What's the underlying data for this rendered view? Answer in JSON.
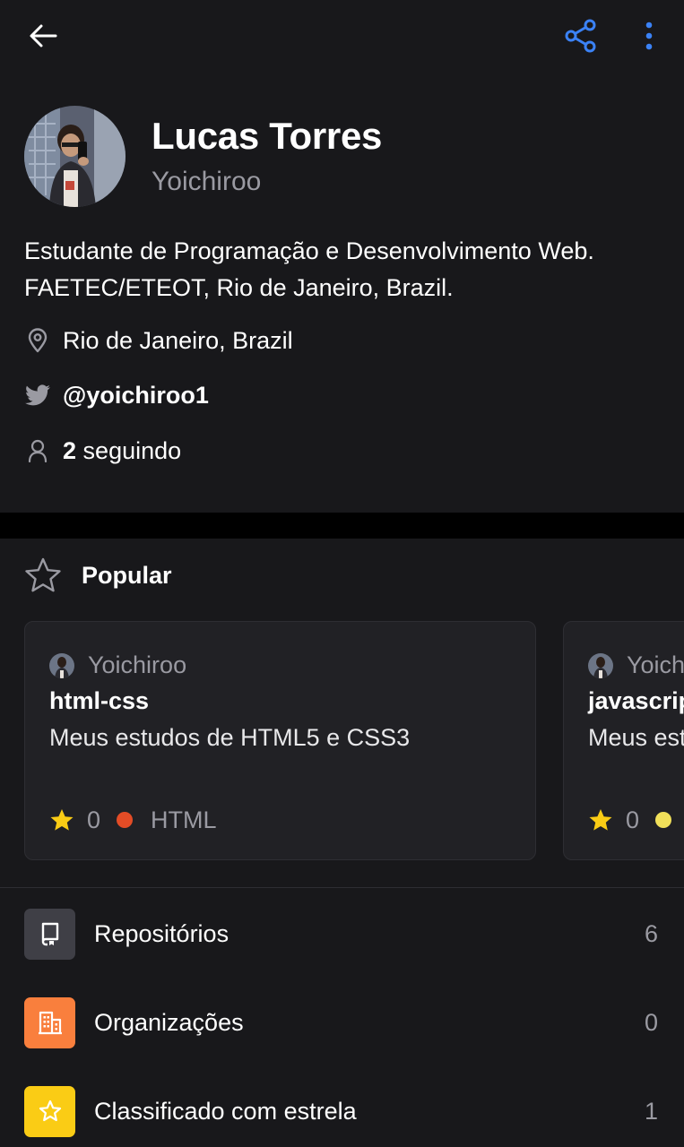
{
  "header": {
    "back_icon": "arrow-left-icon",
    "share_icon": "share-icon",
    "more_icon": "kebab-menu-icon",
    "accent": "#3b82f6"
  },
  "profile": {
    "name": "Lucas Torres",
    "login": "Yoichiroo",
    "bio_line1": "Estudante de Programação e Desenvolvimento Web.",
    "bio_line2": "FAETEC/ETEOT, Rio de Janeiro, Brazil.",
    "location": "Rio de Janeiro, Brazil",
    "twitter": "@yoichiroo1",
    "following_count": "2",
    "following_label": "seguindo"
  },
  "popular": {
    "title": "Popular",
    "cards": [
      {
        "owner": "Yoichiroo",
        "name": "html-css",
        "description": "Meus estudos de HTML5 e CSS3",
        "stars": "0",
        "language": "HTML",
        "language_color": "#e34c26"
      },
      {
        "owner": "Yoichiroo",
        "name": "javascript",
        "description": "Meus estudos",
        "stars": "0",
        "language": "",
        "language_color": "#f1e05a"
      }
    ]
  },
  "menu": [
    {
      "label": "Repositórios",
      "count": "6",
      "icon": "repo-icon",
      "color": "#3f3f46"
    },
    {
      "label": "Organizações",
      "count": "0",
      "icon": "organization-icon",
      "color": "#f97f3d"
    },
    {
      "label": "Classificado com estrela",
      "count": "1",
      "icon": "star-icon",
      "color": "#facc15"
    }
  ]
}
